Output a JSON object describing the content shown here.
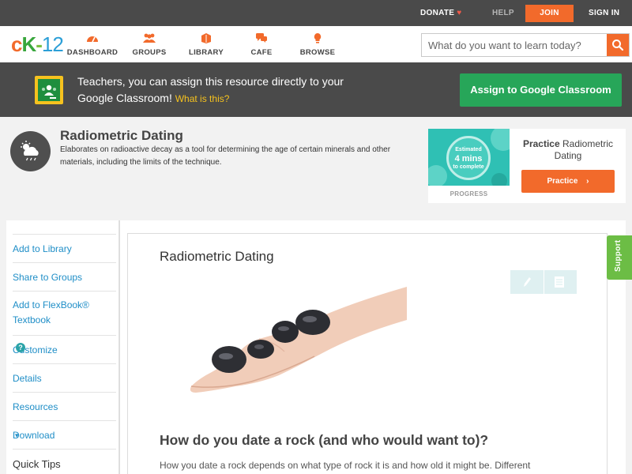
{
  "topbar": {
    "donate": "DONATE",
    "help": "HELP",
    "join": "JOIN",
    "signin": "SIGN IN"
  },
  "logo": {
    "c": "c",
    "k": "K",
    "dash": "-",
    "n": "12"
  },
  "nav": {
    "items": [
      {
        "label": "DASHBOARD",
        "icon": "dashboard-icon"
      },
      {
        "label": "GROUPS",
        "icon": "groups-icon"
      },
      {
        "label": "LIBRARY",
        "icon": "library-icon"
      },
      {
        "label": "CAFE",
        "icon": "cafe-icon"
      },
      {
        "label": "BROWSE",
        "icon": "browse-icon"
      }
    ],
    "search_placeholder": "What do you want to learn today?"
  },
  "banner": {
    "message": "Teachers, you can assign this resource directly to your Google Classroom!",
    "what_link": "What is this?",
    "assign_button": "Assign to Google Classroom"
  },
  "concept": {
    "title": "Radiometric Dating",
    "description": "Elaborates on radioactive decay as a tool for determining the age of certain minerals and other materials, including the limits of the technique."
  },
  "practice": {
    "estimated": "Estimated",
    "mins": "4 mins",
    "to_complete": "to complete",
    "progress_label": "PROGRESS",
    "title_bold": "Practice",
    "title_rest": "Radiometric Dating",
    "button": "Practice"
  },
  "sidebar": {
    "items": [
      {
        "label": "Add to Library"
      },
      {
        "label": "Share to Groups"
      },
      {
        "label": "Add to FlexBook® Textbook"
      },
      {
        "label": "Customize"
      },
      {
        "label": "Details"
      },
      {
        "label": "Resources"
      },
      {
        "label": "Download"
      },
      {
        "label": "Quick Tips"
      }
    ],
    "help_mark": "?",
    "download_caret": "▾"
  },
  "content": {
    "title": "Radiometric Dating",
    "heading": "How do you date a rock (and who would want to)?",
    "paragraph": "How you date a rock depends on what type of rock it is and how old it might be. Different"
  },
  "support": "Support",
  "colors": {
    "accent_orange": "#f26a2b",
    "dark_bar": "#4a4a4a",
    "google_green": "#27a659",
    "link_blue": "#1f8ec7",
    "support_green": "#6cbd45"
  }
}
